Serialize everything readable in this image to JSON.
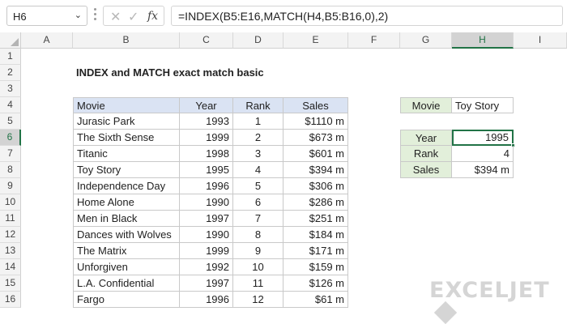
{
  "formula_bar": {
    "name_box": "H6",
    "formula": "=INDEX(B5:E16,MATCH(H4,B5:B16,0),2)"
  },
  "columns": [
    "A",
    "B",
    "C",
    "D",
    "E",
    "F",
    "G",
    "H",
    "I"
  ],
  "rows": [
    "1",
    "2",
    "3",
    "4",
    "5",
    "6",
    "7",
    "8",
    "9",
    "10",
    "11",
    "12",
    "13",
    "14",
    "15",
    "16"
  ],
  "title": "INDEX and MATCH exact match basic",
  "table": {
    "headers": [
      "Movie",
      "Year",
      "Rank",
      "Sales"
    ],
    "rows": [
      [
        "Jurasic Park",
        "1993",
        "1",
        "$1110 m"
      ],
      [
        "The Sixth Sense",
        "1999",
        "2",
        "$673 m"
      ],
      [
        "Titanic",
        "1998",
        "3",
        "$601 m"
      ],
      [
        "Toy Story",
        "1995",
        "4",
        "$394 m"
      ],
      [
        "Independence Day",
        "1996",
        "5",
        "$306 m"
      ],
      [
        "Home Alone",
        "1990",
        "6",
        "$286 m"
      ],
      [
        "Men in Black",
        "1997",
        "7",
        "$251 m"
      ],
      [
        "Dances with Wolves",
        "1990",
        "8",
        "$184 m"
      ],
      [
        "The Matrix",
        "1999",
        "9",
        "$171 m"
      ],
      [
        "Unforgiven",
        "1992",
        "10",
        "$159 m"
      ],
      [
        "L.A. Confidential",
        "1997",
        "11",
        "$126 m"
      ],
      [
        "Fargo",
        "1996",
        "12",
        "$61 m"
      ]
    ]
  },
  "lookup": {
    "movie_label": "Movie",
    "movie_value": "Toy Story",
    "year_label": "Year",
    "year_value": "1995",
    "rank_label": "Rank",
    "rank_value": "4",
    "sales_label": "Sales",
    "sales_value": "$394 m"
  },
  "selected_cell": "H6",
  "brand": "EXCELJET",
  "colors": {
    "table_header": "#dae3f3",
    "lookup_label": "#e2efda",
    "selection": "#217346"
  }
}
